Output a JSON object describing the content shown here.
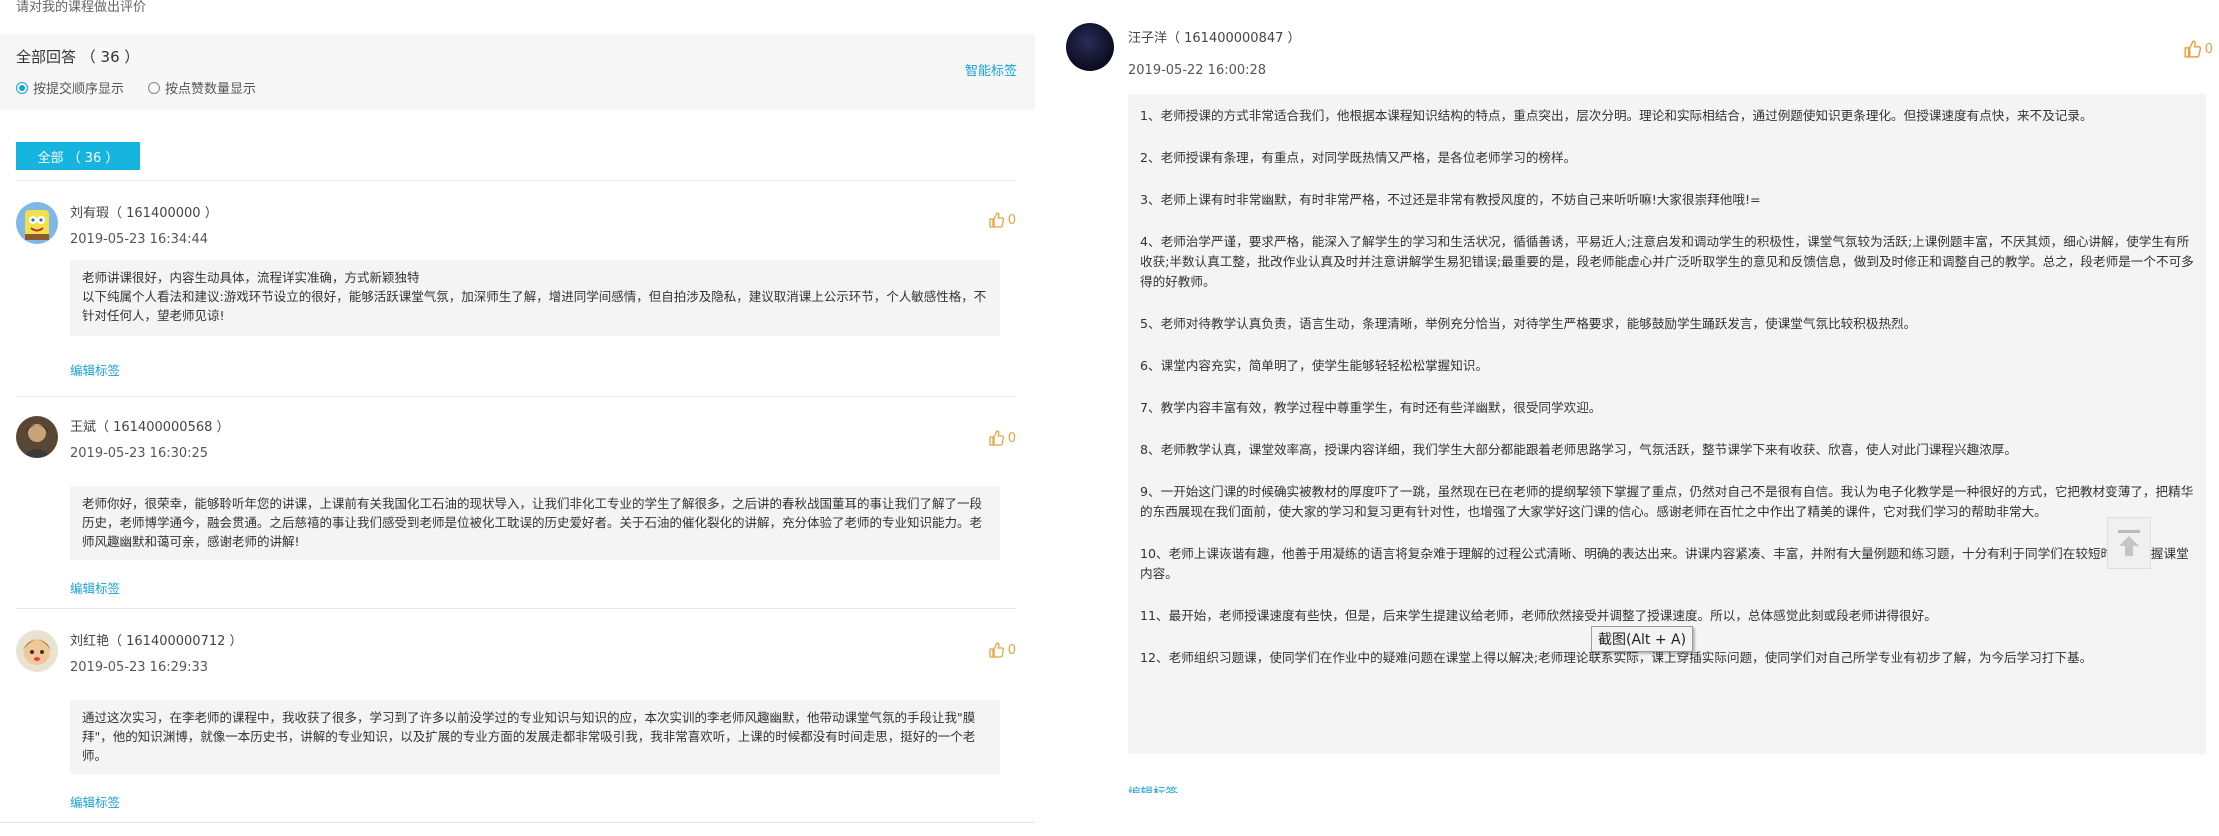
{
  "left": {
    "prompt": "请对我的课程做出评价",
    "answers_label": "全部回答 （ 36 ）",
    "sort_by_time": "按提交顺序显示",
    "sort_by_likes": "按点赞数量显示",
    "smart_tag": "智能标签",
    "filter_all": "全部 （ 36 ）",
    "comments": [
      {
        "name": "刘有瑕（ 161400000 ）",
        "date": "2019-05-23 16:34:44",
        "text": "老师讲课很好，内容生动具体，流程详实准确，方式新颖独特\n以下纯属个人看法和建议:游戏环节设立的很好，能够活跃课堂气氛，加深师生了解，增进同学间感情，但自拍涉及隐私，建议取消课上公示环节，个人敏感性格，不针对任何人，望老师见谅!",
        "likes": "0",
        "edit_tag": "编辑标签"
      },
      {
        "name": "王斌（ 161400000568 ）",
        "date": "2019-05-23 16:30:25",
        "text": "老师你好，很荣幸，能够聆听年您的讲课，上课前有关我国化工石油的现状导入，让我们非化工专业的学生了解很多，之后讲的春秋战国董耳的事让我们了解了一段历史，老师博学通今，融会贯通。之后慈禧的事让我们感受到老师是位被化工耽误的历史爱好者。关于石油的催化裂化的讲解，充分体验了老师的专业知识能力。老师风趣幽默和蔼可亲，感谢老师的讲解!",
        "likes": "0",
        "edit_tag": "编辑标签"
      },
      {
        "name": "刘红艳（ 161400000712 ）",
        "date": "2019-05-23 16:29:33",
        "text": "通过这次实习，在李老师的课程中，我收获了很多，学习到了许多以前没学过的专业知识与知识的应，本次实训的李老师风趣幽默，他带动课堂气氛的手段让我\"膜拜\"，他的知识渊博，就像一本历史书，讲解的专业知识，以及扩展的专业方面的发展走都非常吸引我，我非常喜欢听，上课的时候都没有时间走思，挺好的一个老师。",
        "likes": "0",
        "edit_tag": "编辑标签"
      }
    ]
  },
  "right": {
    "name": "汪子洋（ 161400000847 ）",
    "date": "2019-05-22 16:00:28",
    "likes": "0",
    "items": [
      "1、老师授课的方式非常适合我们，他根据本课程知识结构的特点，重点突出，层次分明。理论和实际相结合，通过例题使知识更条理化。但授课速度有点快，来不及记录。",
      "2、老师授课有条理，有重点，对同学既热情又严格，是各位老师学习的榜样。",
      "3、老师上课有时非常幽默，有时非常严格，不过还是非常有教授风度的，不妨自己来听听嘛!大家很崇拜他哦!=",
      "4、老师治学严谨，要求严格，能深入了解学生的学习和生活状况，循循善诱，平易近人;注意启发和调动学生的积极性，课堂气氛较为活跃;上课例题丰富，不厌其烦，细心讲解，使学生有所收获;半数认真工整，批改作业认真及时并注意讲解学生易犯错误;最重要的是，段老师能虚心并广泛听取学生的意见和反馈信息，做到及时修正和调整自己的教学。总之，段老师是一个不可多得的好教师。",
      "5、老师对待教学认真负责，语言生动，条理清晰，举例充分恰当，对待学生严格要求，能够鼓励学生踊跃发言，使课堂气氛比较积极热烈。",
      "6、课堂内容充实，简单明了，使学生能够轻轻松松掌握知识。",
      "7、教学内容丰富有效，教学过程中尊重学生，有时还有些洋幽默，很受同学欢迎。",
      "8、老师教学认真，课堂效率高，授课内容详细，我们学生大部分都能跟着老师思路学习，气氛活跃，整节课学下来有收获、欣喜，使人对此门课程兴趣浓厚。",
      "9、一开始这门课的时候确实被教材的厚度吓了一跳，虽然现在已在老师的提纲挈领下掌握了重点，仍然对自己不是很有自信。我认为电子化教学是一种很好的方式，它把教材变薄了，把精华的东西展现在我们面前，使大家的学习和复习更有针对性，也增强了大家学好这门课的信心。感谢老师在百忙之中作出了精美的课件，它对我们学习的帮助非常大。",
      "10、老师上课诙谐有趣，他善于用凝练的语言将复杂难于理解的过程公式清晰、明确的表达出来。讲课内容紧凑、丰富，并附有大量例题和练习题，十分有利于同学们在较短时间内掌握课堂内容。",
      "11、最开始，老师授课速度有些快，但是，后来学生提建议给老师，老师欣然接受并调整了授课速度。所以，总体感觉此刻或段老师讲得很好。",
      "12、老师组织习题课，使同学们在作业中的疑难问题在课堂上得以解决;老师理论联系实际，课上穿插实际问题，使同学们对自己所学专业有初步了解，为今后学习打下基。"
    ],
    "edit_tag": "编辑标签"
  },
  "tooltip": "截图(Alt + A)",
  "colors": {
    "accent": "#16a3d6",
    "button": "#16b5e0",
    "like": "#e8a33d"
  }
}
